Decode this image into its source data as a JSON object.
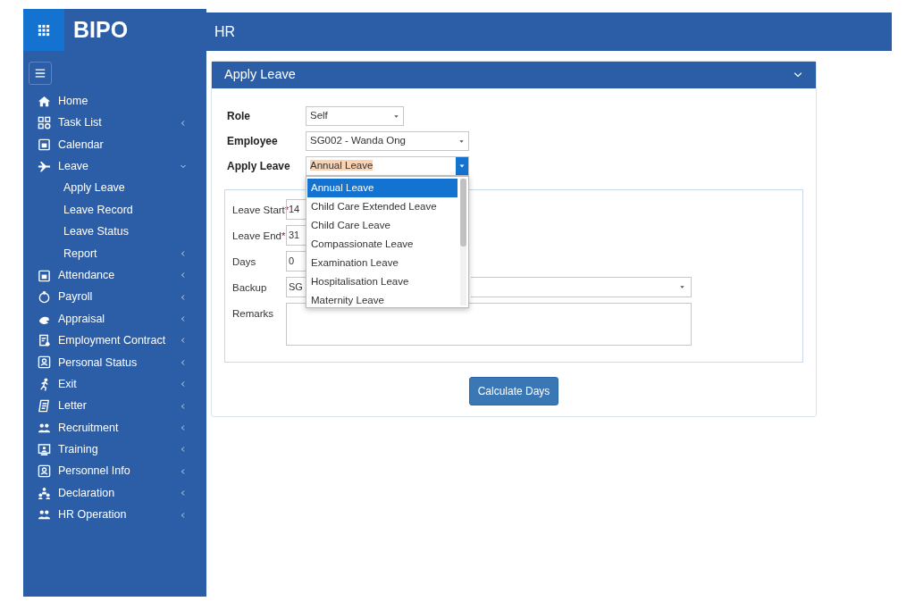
{
  "brand": {
    "logo_text": "BIPO"
  },
  "header": {
    "title": "HR"
  },
  "sidebar": {
    "items": [
      {
        "label": "Home"
      },
      {
        "label": "Task List",
        "expanded": false
      },
      {
        "label": "Calendar"
      },
      {
        "label": "Leave",
        "expanded": true,
        "children": [
          {
            "label": "Apply Leave"
          },
          {
            "label": "Leave Record"
          },
          {
            "label": "Leave Status"
          },
          {
            "label": "Report",
            "expanded": false
          }
        ]
      },
      {
        "label": "Attendance",
        "expanded": false
      },
      {
        "label": "Payroll",
        "expanded": false
      },
      {
        "label": "Appraisal",
        "expanded": false
      },
      {
        "label": "Employment Contract",
        "expanded": false
      },
      {
        "label": "Personal Status",
        "expanded": false
      },
      {
        "label": "Exit",
        "expanded": false
      },
      {
        "label": "Letter",
        "expanded": false
      },
      {
        "label": "Recruitment",
        "expanded": false
      },
      {
        "label": "Training",
        "expanded": false
      },
      {
        "label": "Personnel Info",
        "expanded": false
      },
      {
        "label": "Declaration",
        "expanded": false
      },
      {
        "label": "HR Operation",
        "expanded": false
      }
    ]
  },
  "panel": {
    "title": "Apply Leave",
    "form": [
      {
        "label": "Role",
        "value": "Self"
      },
      {
        "label": "Employee",
        "value": "SG002 - Wanda Ong"
      },
      {
        "label": "Apply Leave",
        "value": "Annual Leave",
        "open": true,
        "options": [
          {
            "label": "Annual Leave",
            "selected": true
          },
          {
            "label": "Child Care Extended Leave",
            "selected": false
          },
          {
            "label": "Child Care Leave",
            "selected": false
          },
          {
            "label": "Compassionate Leave",
            "selected": false
          },
          {
            "label": "Examination Leave",
            "selected": false
          },
          {
            "label": "Hospitalisation Leave",
            "selected": false
          },
          {
            "label": "Maternity Leave",
            "selected": false
          }
        ]
      }
    ],
    "details": [
      {
        "kind": "input",
        "label": "Leave Start",
        "required_mark": "*",
        "value": "14"
      },
      {
        "kind": "input",
        "label": "Leave End",
        "required_mark": "*",
        "value": "31"
      },
      {
        "kind": "input",
        "label": "Days",
        "value": "0"
      },
      {
        "kind": "select",
        "label": "Backup",
        "value": "SG"
      },
      {
        "kind": "textarea",
        "label": "Remarks"
      }
    ],
    "buttons": [
      {
        "label": "Calculate Days"
      }
    ]
  }
}
